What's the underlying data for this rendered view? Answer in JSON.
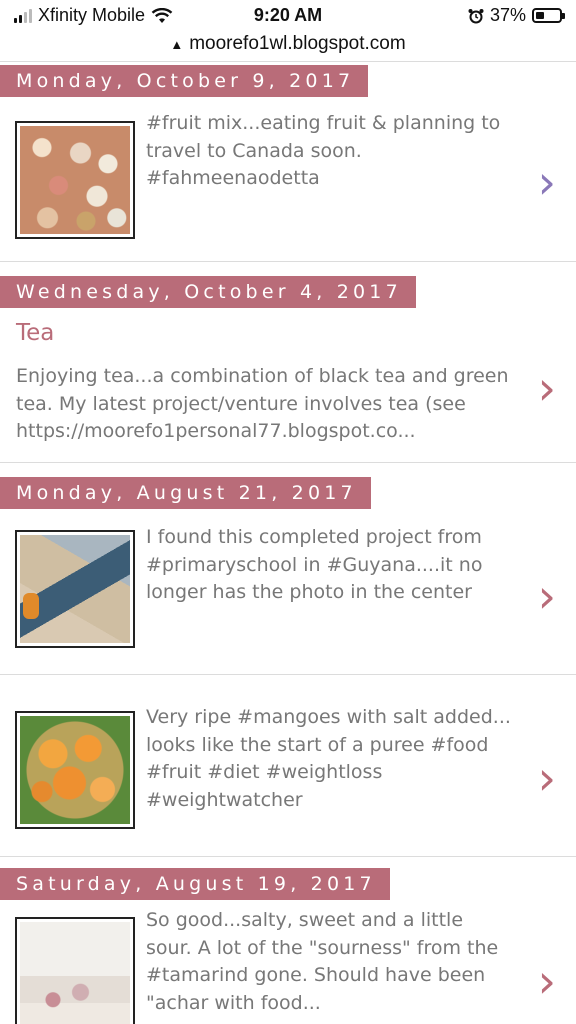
{
  "status_bar": {
    "carrier": "Xfinity Mobile",
    "time": "9:20 AM",
    "battery": "37%",
    "battery_level": 0.37
  },
  "url_bar": {
    "url": "moorefo1wl.blogspot.com"
  },
  "colors": {
    "banner": "#b96c79",
    "chevron_purple": "#8a78b8",
    "chevron_rose": "#b96c79",
    "snippet_text": "#777777"
  },
  "posts": [
    {
      "date": "Monday, October 9, 2017",
      "title": "",
      "snippet": "#fruit mix...eating fruit & planning to\ntravel to Canada soon.\n#fahmeenaodetta",
      "thumbnail": "fruit-photo",
      "chevron": "›"
    },
    {
      "date": "Wednesday, October 4, 2017",
      "title": "Tea",
      "snippet": "Enjoying tea...a combination of black tea and green\ntea. My latest project/venture involves tea (see\nhttps://moorefo1personal77.blogspot.co...",
      "thumbnail": "",
      "chevron": "›"
    },
    {
      "date": "Monday, August 21, 2017",
      "title": "",
      "snippet": "I found this completed project from\n#primaryschool in #Guyana....it no\nlonger has the photo in the center",
      "thumbnail": "cloth-photo",
      "chevron": "›"
    },
    {
      "date": "",
      "title": "",
      "snippet": "Very ripe #mangoes with salt added...\nlooks like the start of a puree #food\n#fruit #diet #weightloss\n#weightwatcher",
      "thumbnail": "mango-photo",
      "chevron": "›"
    },
    {
      "date": "Saturday, August 19, 2017",
      "title": "",
      "snippet": "So good...salty, sweet and a little\nsour. A lot of the \"sourness\" from the\n#tamarind gone.  Should have been\n\"achar with food...",
      "thumbnail": "tamarind-photo",
      "chevron": "›"
    }
  ]
}
